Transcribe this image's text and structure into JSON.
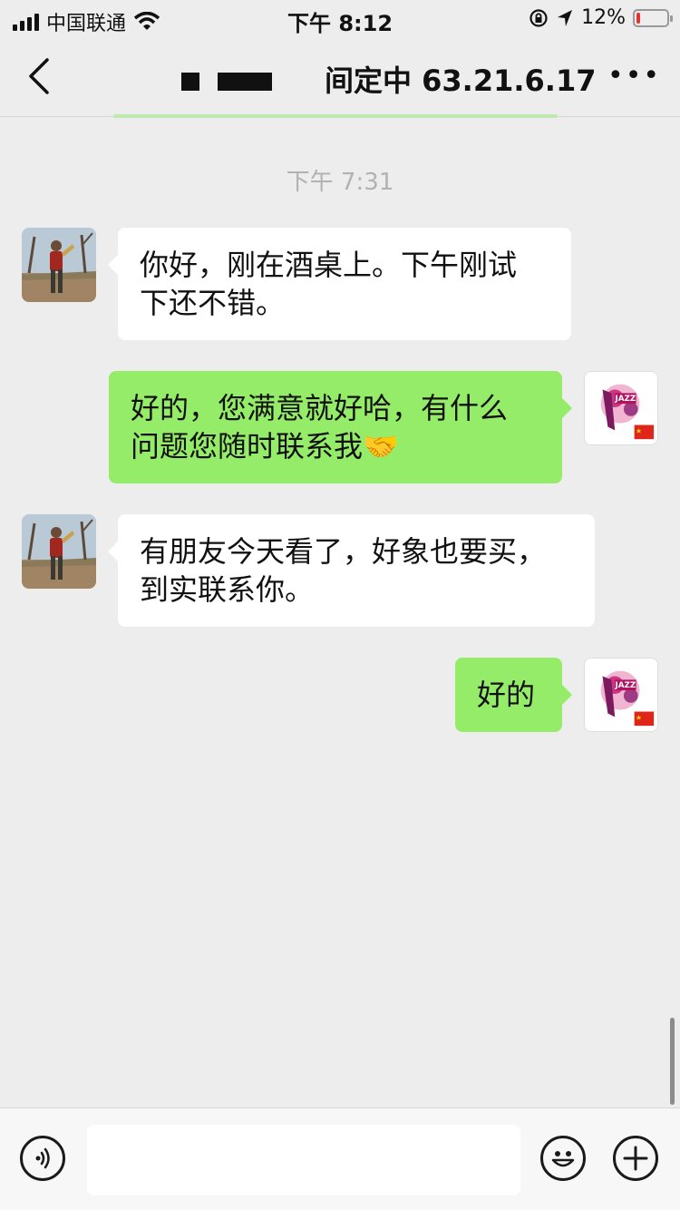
{
  "status_bar": {
    "carrier": "中国联通",
    "time": "下午 8:12",
    "battery_percent": "12%",
    "battery_level": 0.12,
    "icons": [
      "signal-icon",
      "wifi-icon",
      "orientation-lock-icon",
      "location-arrow-icon",
      "battery-icon"
    ]
  },
  "nav": {
    "title_visible": "间定中 63.21.6.17",
    "more_label": "•••",
    "icons": [
      "back-chevron-icon",
      "more-icon"
    ]
  },
  "chat": {
    "timestamp": "下午 7:31",
    "messages": [
      {
        "side": "in",
        "text": "你好，刚在酒桌上。下午刚试\n下还不错。"
      },
      {
        "side": "out",
        "text": "好的，您满意就好哈，有什么\n问题您随时联系我🤝"
      },
      {
        "side": "in",
        "text": "有朋友今天看了，好象也要买，\n到实联系你。"
      },
      {
        "side": "out",
        "text": "好的"
      }
    ],
    "avatars": {
      "contact": "saxophone-player-photo",
      "self": "jazz-logo-with-china-flag"
    }
  },
  "input_bar": {
    "placeholder": "",
    "icons": [
      "voice-icon",
      "emoji-icon",
      "plus-icon"
    ]
  },
  "colors": {
    "background": "#ededed",
    "outgoing_bubble": "#95ec69",
    "incoming_bubble": "#ffffff",
    "battery_low": "#e3342f"
  }
}
